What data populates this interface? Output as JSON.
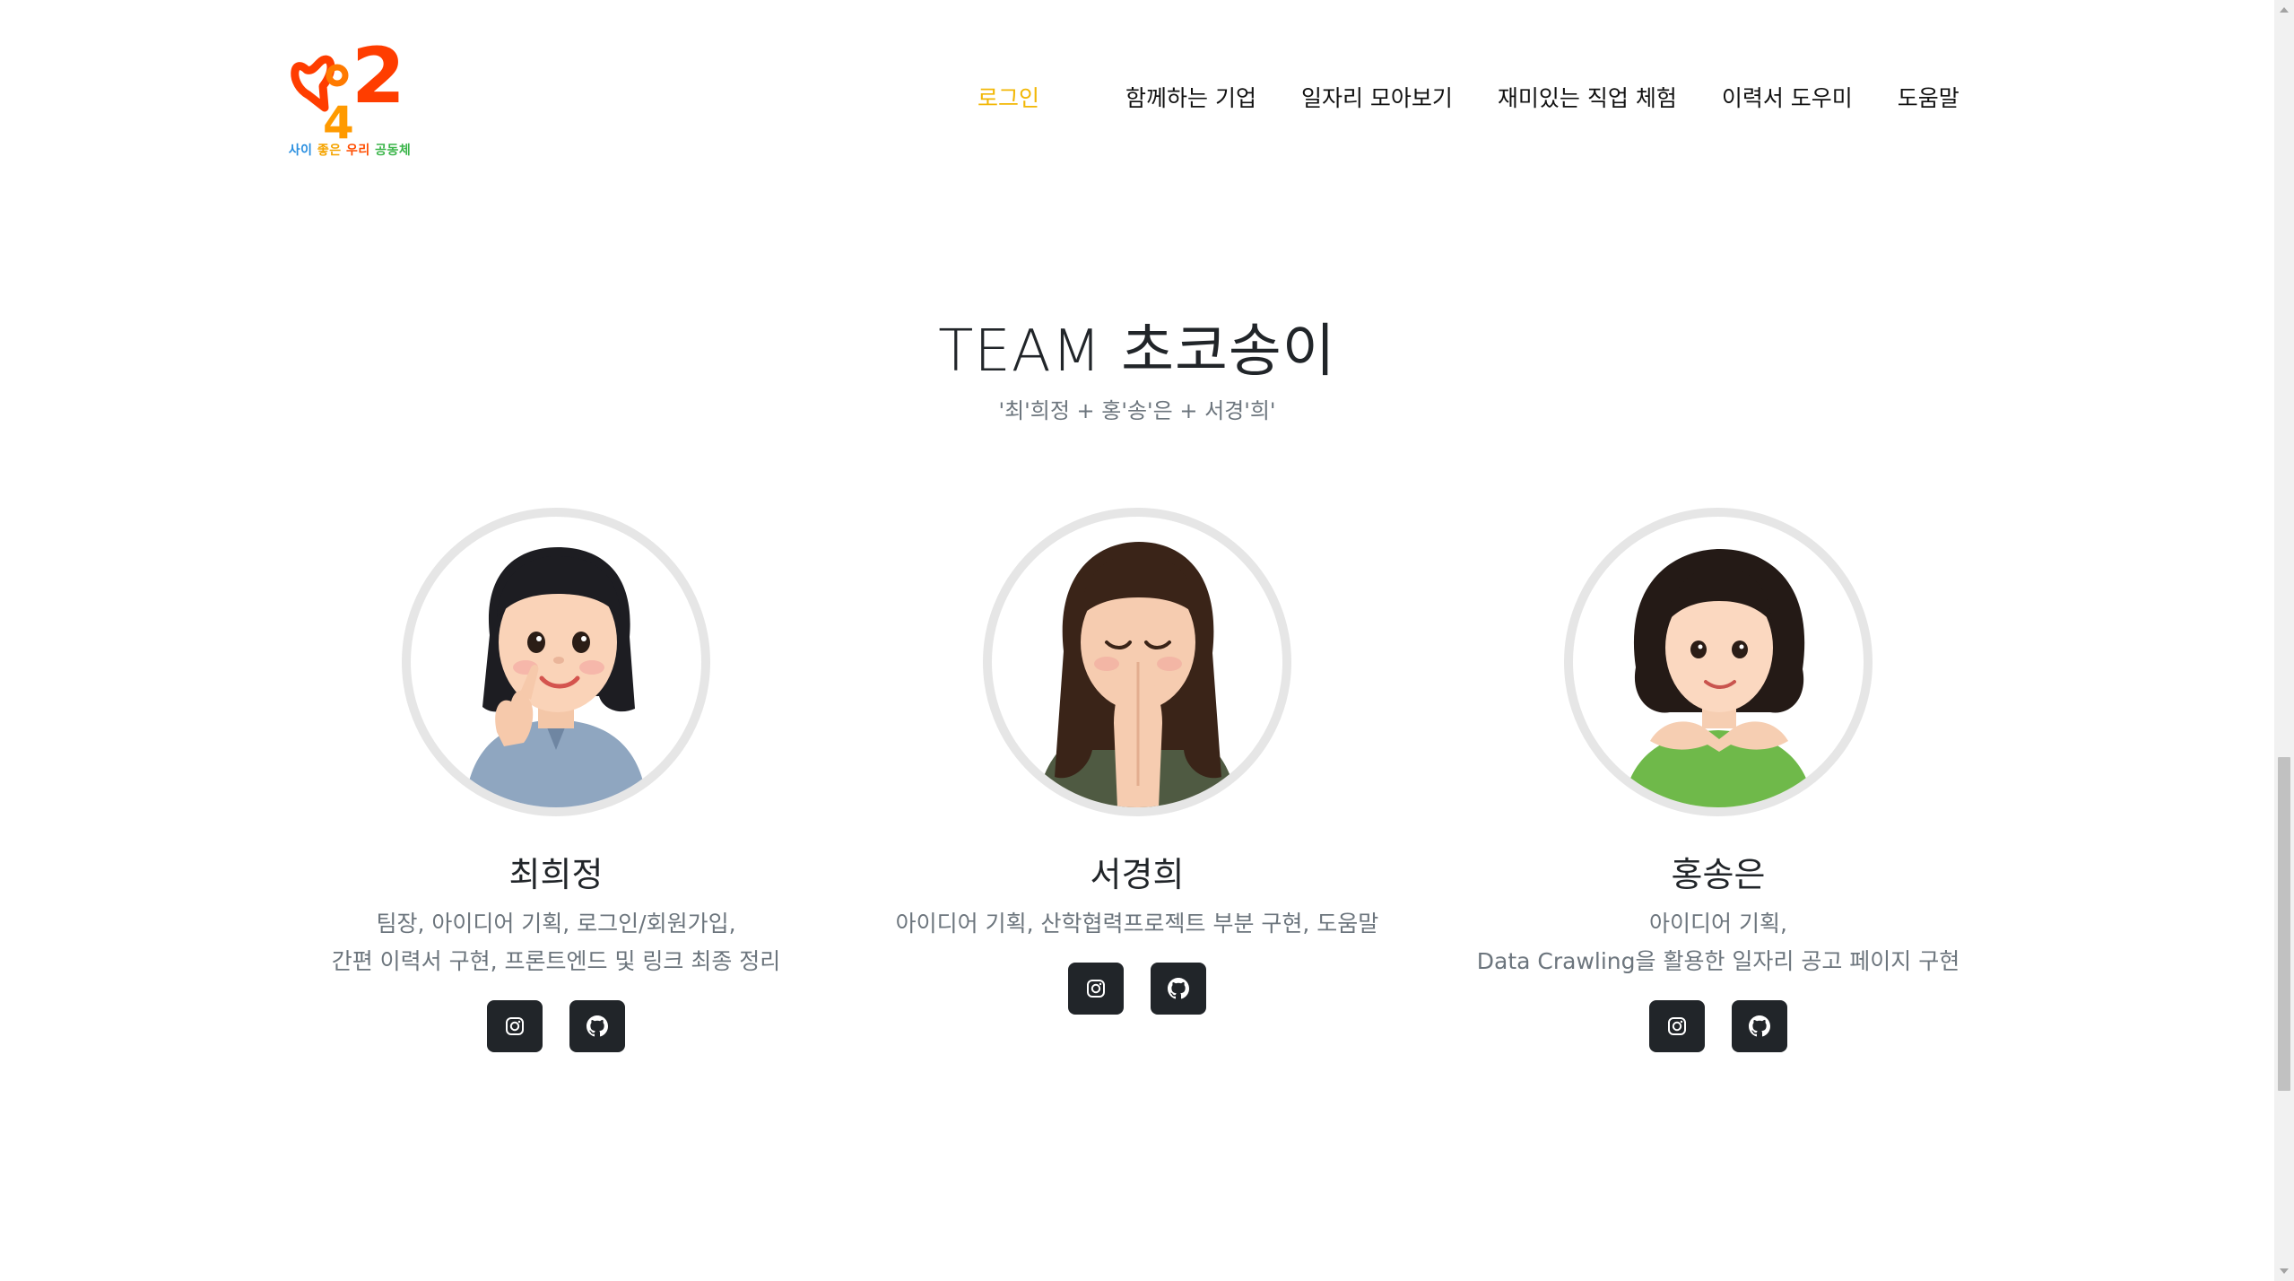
{
  "header": {
    "logo": {
      "mark_text": "2",
      "mark_subtext": "4",
      "caption_parts": [
        "사이",
        "좋은",
        "우리",
        "공동체"
      ]
    },
    "nav": [
      {
        "label": "로그인",
        "active": true
      },
      {
        "label": "함께하는 기업",
        "active": false
      },
      {
        "label": "일자리 모아보기",
        "active": false
      },
      {
        "label": "재미있는 직업 체험",
        "active": false
      },
      {
        "label": "이력서 도우미",
        "active": false
      },
      {
        "label": "도움말",
        "active": false
      }
    ]
  },
  "team": {
    "title": "TEAM 초코송이",
    "subtitle": "'최'희정 + 홍'송'은 + 서경'희'",
    "members": [
      {
        "name": "최희정",
        "role_lines": [
          "팀장, 아이디어 기획, 로그인/회원가입,",
          "간편 이력서 구현, 프론트엔드 및 링크 최종 정리"
        ],
        "avatar": "memoji-finger-heart-icon",
        "links": [
          "instagram-icon",
          "github-icon"
        ]
      },
      {
        "name": "서경희",
        "role_lines": [
          "아이디어 기획, 산학협력프로젝트 부분 구현, 도움말"
        ],
        "avatar": "memoji-praying-hands-icon",
        "links": [
          "instagram-icon",
          "github-icon"
        ]
      },
      {
        "name": "홍송은",
        "role_lines": [
          "아이디어 기획,",
          "Data Crawling을 활용한 일자리 공고 페이지 구현"
        ],
        "avatar": "memoji-chin-rest-icon",
        "links": [
          "instagram-icon",
          "github-icon"
        ]
      }
    ]
  },
  "colors": {
    "nav_active": "#f2b705",
    "text_dark": "#212529",
    "text_muted": "#6c757d",
    "avatar_ring": "#e6e6e6",
    "social_button": "#212529"
  }
}
